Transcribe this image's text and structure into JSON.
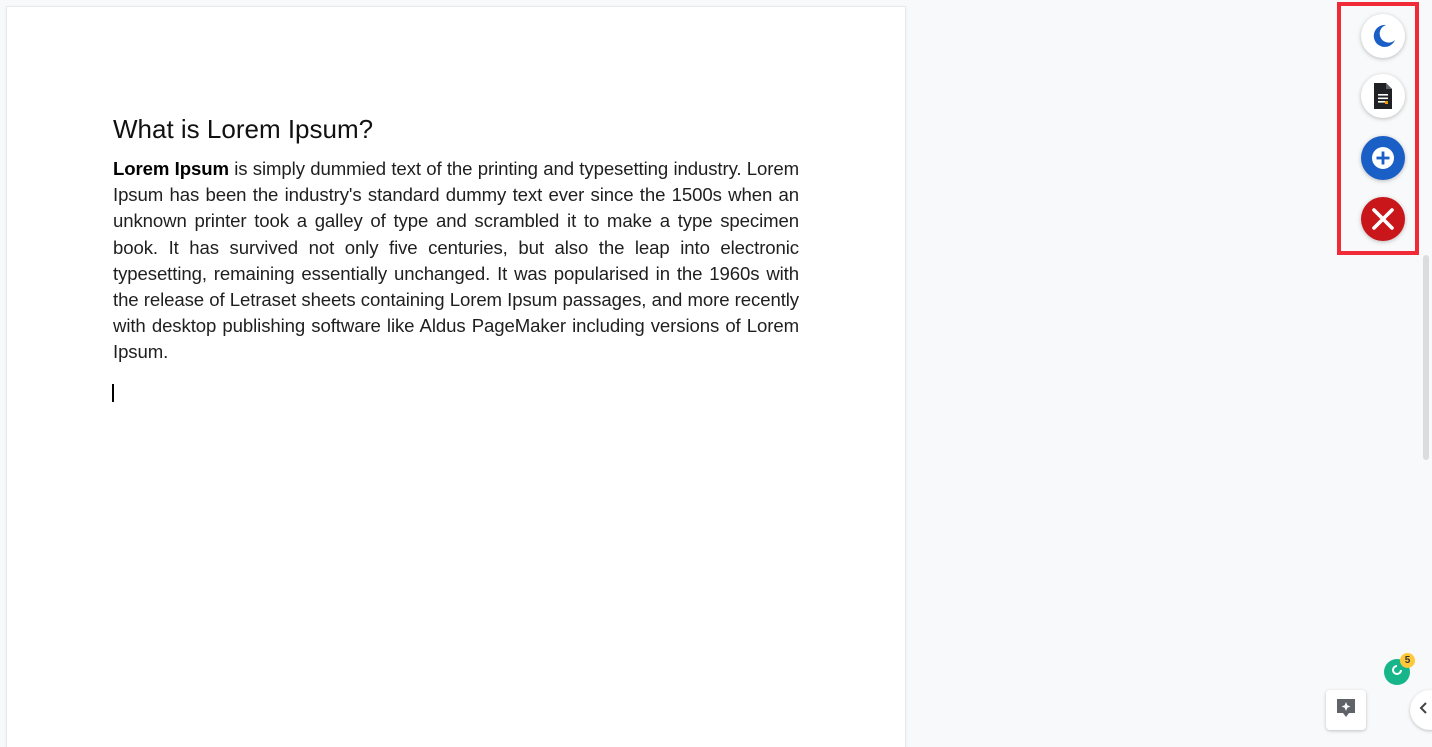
{
  "document": {
    "heading": "What is Lorem Ipsum?",
    "paragraph_bold": "Lorem Ipsum",
    "paragraph_rest": " is simply dummied text of the printing and typesetting industry. Lorem Ipsum has been the industry's standard dummy text ever since the 1500s when an unknown printer took a galley of type and scrambled it to make a type specimen book. It has survived not only five centuries, but also the leap into electronic typesetting, remaining essentially unchanged. It was popularised in the 1960s with the release of Letraset sheets containing Lorem Ipsum passages, and more recently with desktop publishing software like Aldus PageMaker including versions of Lorem Ipsum."
  },
  "floating_toolbar": {
    "highlight_color": "#f02a37",
    "buttons": [
      {
        "icon": "crescent-moon-icon",
        "color": "#1a5fc6"
      },
      {
        "icon": "document-icon",
        "color": "#202124"
      },
      {
        "icon": "plus-circle-icon",
        "color": "#1a5fc6"
      },
      {
        "icon": "close-x-icon",
        "color": "#c8161b"
      }
    ]
  },
  "grammar_widget": {
    "count": "5",
    "color": "#17b58a",
    "badge_color": "#ffc83a"
  },
  "bottom_controls": {
    "explore_icon": "explore-sparkle-icon",
    "side_panel_icon": "chevron-left-icon"
  }
}
